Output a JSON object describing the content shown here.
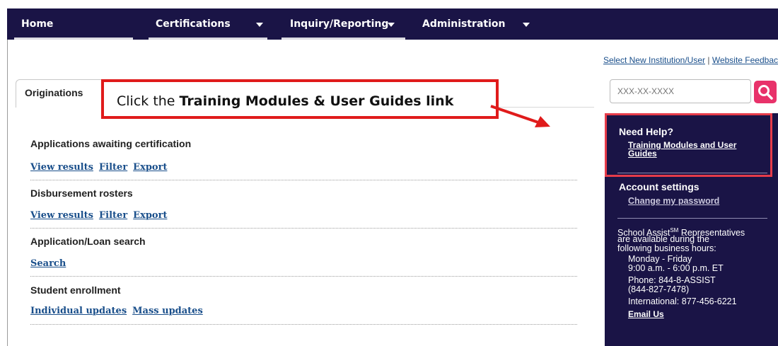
{
  "nav": {
    "items": [
      {
        "label": "Home"
      },
      {
        "label": "Certifications"
      },
      {
        "label": "Inquiry/Reporting"
      },
      {
        "label": "Administration"
      }
    ]
  },
  "top_links": {
    "select_new": "Select New Institution/User",
    "separator": "|",
    "feedback": "Website Feedbac"
  },
  "tab": {
    "label": "Originations"
  },
  "callout": {
    "prefix": "Click the ",
    "bold": "Training Modules & User Guides link"
  },
  "sections": [
    {
      "title": "Applications awaiting certification",
      "links": [
        "View results",
        "Filter",
        "Export"
      ]
    },
    {
      "title": "Disbursement rosters",
      "links": [
        "View results",
        "Filter",
        "Export"
      ]
    },
    {
      "title": "Application/Loan search",
      "links": [
        "Search"
      ]
    },
    {
      "title": "Student enrollment",
      "links": [
        "Individual updates",
        "Mass updates"
      ]
    }
  ],
  "search": {
    "placeholder": "XXX-XX-XXXX",
    "icon": "search-icon"
  },
  "sidebar": {
    "need_help": "Need Help?",
    "training_line1": "Training Modules and User",
    "training_line2": "Guides",
    "account_settings": "Account settings",
    "change_password": "Change my password",
    "rep_line1": "School Assist",
    "rep_sup": "SM",
    "rep_line1_tail": " Representatives",
    "rep_line2": "are available during the",
    "rep_line3": "following business hours:",
    "days": "Monday - Friday",
    "hours": "9:00 a.m. - 6:00 p.m. ET",
    "phone1": "Phone: 844-8-ASSIST",
    "phone2": "(844-827-7478)",
    "international": "International: 877-456-6221",
    "email": "Email Us"
  },
  "colors": {
    "nav_bg": "#1a1446",
    "accent": "#e8326a",
    "callout_border": "#e01b1b",
    "link": "#1a4f8b"
  }
}
